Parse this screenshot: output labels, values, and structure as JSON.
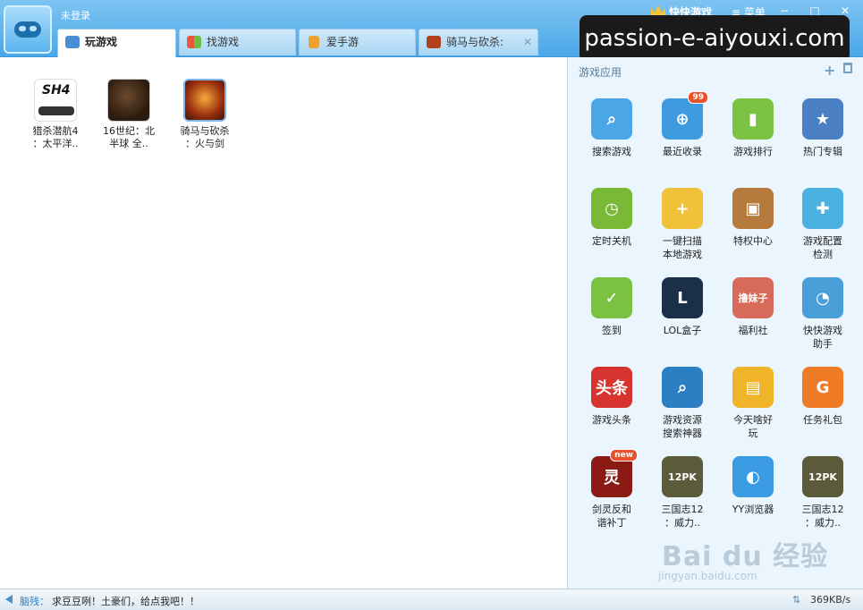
{
  "header": {
    "login_status": "未登录",
    "brand": "快快游戏",
    "menu": "≡ 菜单",
    "minimize": "−",
    "maximize": "□",
    "close": "✕"
  },
  "tabs": [
    {
      "label": "玩游戏",
      "active": true
    },
    {
      "label": "找游戏",
      "active": false
    },
    {
      "label": "爱手游",
      "active": false
    },
    {
      "label": "骑马与砍杀:",
      "active": false,
      "close": "✕"
    }
  ],
  "overlay_watermark": "passion-e-aiyouxi.com",
  "games": [
    {
      "line1": "猎杀潜航4",
      "line2": "：太平洋..",
      "icon_text": "SH4"
    },
    {
      "line1": "16世纪：北",
      "line2": "半球 全..",
      "icon_text": ""
    },
    {
      "line1": "骑马与砍杀",
      "line2": "：火与剑",
      "icon_text": ""
    }
  ],
  "panel": {
    "title": "游戏应用",
    "add": "+",
    "apps": [
      {
        "line1": "搜索游戏",
        "line2": "",
        "glyph": "⌕",
        "color": "#4aa6e6"
      },
      {
        "line1": "最近收录",
        "line2": "",
        "glyph": "⊕",
        "color": "#3f9be0",
        "badge": "99"
      },
      {
        "line1": "游戏排行",
        "line2": "",
        "glyph": "▮",
        "color": "#7bc142"
      },
      {
        "line1": "热门专辑",
        "line2": "",
        "glyph": "★",
        "color": "#4a7fc4"
      },
      {
        "line1": "定时关机",
        "line2": "",
        "glyph": "◷",
        "color": "#79b935"
      },
      {
        "line1": "一键扫描",
        "line2": "本地游戏",
        "glyph": "+",
        "color": "#f0c23a"
      },
      {
        "line1": "特权中心",
        "line2": "",
        "glyph": "▣",
        "color": "#b57a3c"
      },
      {
        "line1": "游戏配置",
        "line2": "检测",
        "glyph": "✚",
        "color": "#4bb1e0"
      },
      {
        "line1": "签到",
        "line2": "",
        "glyph": "✓",
        "color": "#7bc142"
      },
      {
        "line1": "LOL盒子",
        "line2": "",
        "glyph": "L",
        "color": "#1b2f4a"
      },
      {
        "line1": "福利社",
        "line2": "",
        "glyph": "撸妹子",
        "color": "#d86a5a"
      },
      {
        "line1": "快快游戏",
        "line2": "助手",
        "glyph": "◔",
        "color": "#4b9fd8"
      },
      {
        "line1": "游戏头条",
        "line2": "",
        "glyph": "头条",
        "color": "#d8342f"
      },
      {
        "line1": "游戏资源",
        "line2": "搜索神器",
        "glyph": "⌕",
        "color": "#2d7fc4"
      },
      {
        "line1": "今天啥好",
        "line2": "玩",
        "glyph": "▤",
        "color": "#f0b429"
      },
      {
        "line1": "任务礼包",
        "line2": "",
        "glyph": "G",
        "color": "#f07b26"
      },
      {
        "line1": "剑灵反和",
        "line2": "谐补丁",
        "glyph": "灵",
        "color": "#8c1a14",
        "badge": "new"
      },
      {
        "line1": "三国志12",
        "line2": "：威力..",
        "glyph": "12PK",
        "color": "#5b5a3a"
      },
      {
        "line1": "YY浏览器",
        "line2": "",
        "glyph": "◐",
        "color": "#3a9be2"
      },
      {
        "line1": "三国志12",
        "line2": "：威力..",
        "glyph": "12PK",
        "color": "#5b5a3a"
      }
    ]
  },
  "status": {
    "prefix": "脑残：",
    "message": "求豆豆咧！土豪们，给点我吧！！",
    "speed_icon": "⇅",
    "speed": "369KB/s"
  },
  "watermark": {
    "baidu": "Bai du 经验",
    "jingyan": "jingyan.baidu.com"
  }
}
